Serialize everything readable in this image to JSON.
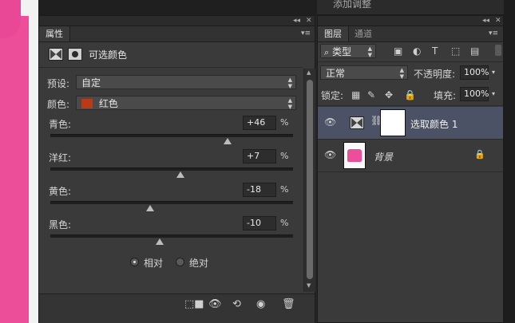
{
  "properties_panel": {
    "tab_label": "属性",
    "header_title": "可选颜色",
    "preset_label": "预设:",
    "preset_value": "自定",
    "colors_label": "颜色:",
    "colors_value": "红色",
    "colors_swatch": "#b83a16",
    "sliders": [
      {
        "label": "青色:",
        "value": "+46",
        "unit": "%",
        "fraction": 0.73
      },
      {
        "label": "洋红:",
        "value": "+7",
        "unit": "%",
        "fraction": 0.535
      },
      {
        "label": "黄色:",
        "value": "-18",
        "unit": "%",
        "fraction": 0.41
      },
      {
        "label": "黑色:",
        "value": "-10",
        "unit": "%",
        "fraction": 0.45
      }
    ],
    "method_relative": "相对",
    "method_absolute": "绝对",
    "method_selected": "relative"
  },
  "layers_panel": {
    "above_title": "添加调整",
    "tab_layers": "图层",
    "tab_channels": "通道",
    "filter_kind": "类型",
    "blend_mode": "正常",
    "opacity_label": "不透明度:",
    "opacity_value": "100%",
    "lock_label": "锁定:",
    "fill_label": "填充:",
    "fill_value": "100%",
    "layers": [
      {
        "name": "选取颜色 1",
        "selected": true
      },
      {
        "name": "背景",
        "selected": false
      }
    ]
  },
  "colors": {
    "panel_bg": "#3a3a3a",
    "selected_layer": "#4b5266",
    "shirt_pink": "#ec4e9a"
  }
}
